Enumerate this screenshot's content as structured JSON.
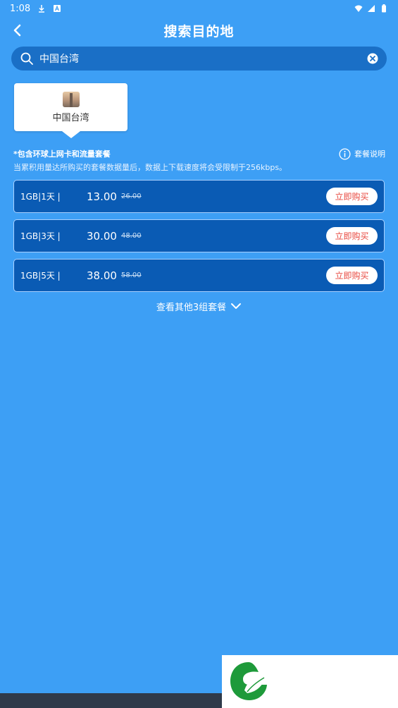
{
  "status_bar": {
    "time": "1:08"
  },
  "header": {
    "title": "搜索目的地"
  },
  "search": {
    "value": "中国台湾"
  },
  "destination": {
    "name": "中国台湾"
  },
  "notice": {
    "title": "*包含环球上网卡和流量套餐",
    "help_label": "套餐说明",
    "description": "当累积用量达所购买的套餐数据量后，数据上下载速度将会受限制于256kbps。"
  },
  "plans": [
    {
      "label": "1GB|1天 |",
      "price": "13.00",
      "original_price": "26.00",
      "buy_label": "立即购买"
    },
    {
      "label": "1GB|3天 |",
      "price": "30.00",
      "original_price": "48.00",
      "buy_label": "立即购买"
    },
    {
      "label": "1GB|5天 |",
      "price": "38.00",
      "original_price": "58.00",
      "buy_label": "立即购买"
    }
  ],
  "more": {
    "label": "查看其他3组套餐"
  },
  "colors": {
    "background": "#3d9ff5",
    "search_bg": "#1a6fc6",
    "plan_bg": "#0a5bb4",
    "buy_text": "#e8483f"
  }
}
